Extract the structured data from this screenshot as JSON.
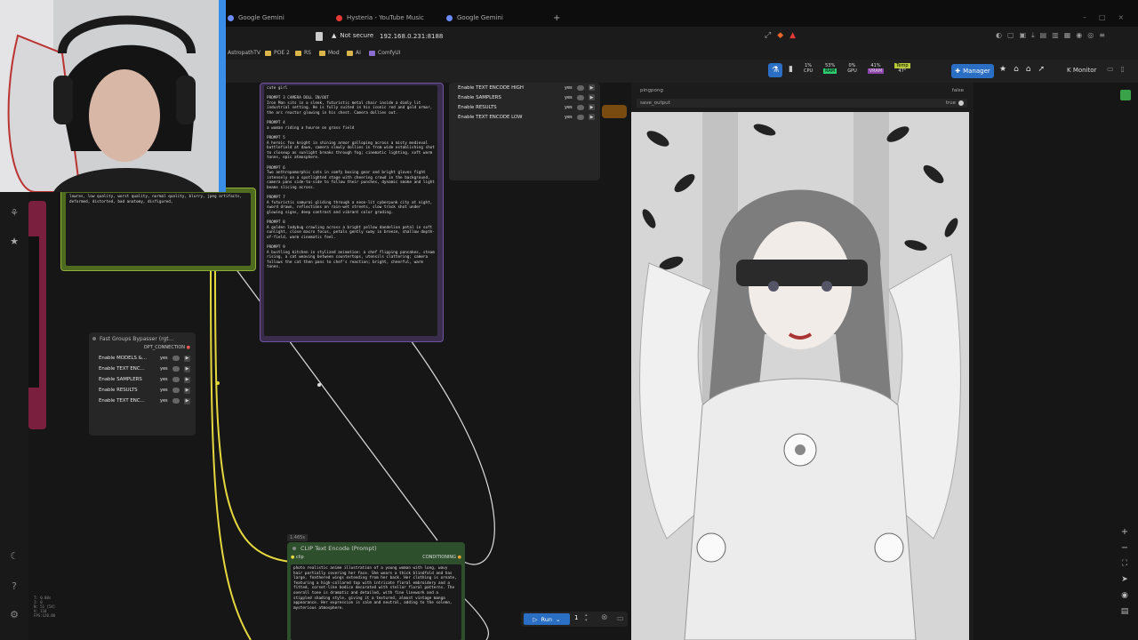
{
  "browser": {
    "tabs": [
      {
        "label": "Google Gemini",
        "accent": "#6b8cff"
      },
      {
        "label": "Hysteria - YouTube Music",
        "accent": "#e53935"
      },
      {
        "label": "Google Gemini",
        "accent": "#6b8cff"
      }
    ],
    "new_tab_glyph": "+",
    "security_label": "Not secure",
    "url": "192.168.0.231:8188",
    "bookmarks": [
      "AstropathTV",
      "POE 2",
      "RS",
      "Mod",
      "AI",
      "ComfyUI"
    ]
  },
  "comfy_toolbar": {
    "stats": [
      {
        "name": "CPU",
        "value": "1%",
        "color": "#2ecc71"
      },
      {
        "name": "RAM",
        "value": "53%",
        "color": "#2ecc71"
      },
      {
        "name": "GPU",
        "value": "0%",
        "color": "#2ecc71"
      },
      {
        "name": "VRAM",
        "value": "41%",
        "color": "#8e44ad"
      },
      {
        "name": "Temp",
        "value": "47°",
        "color": "#b8c93a"
      }
    ],
    "manager_label": "Manager",
    "monitor_label": "Monitor"
  },
  "negative_prompt": {
    "text": "lowres, low quality, worst quality, normal quality, blurry, jpeg artifacts, deformed, distorted, bad anatomy, disfigured,",
    "pill_label": "ING"
  },
  "prompt_list": {
    "text": "cute girl\n\nPROMPT 3 CAMERA DOLL IN/OUT\nIron Man sits in a sleek, futuristic metal chair inside a dimly lit industrial setting. He is fully suited in his iconic red and gold armor, the arc reactor glowing in his chest. Camera dollies out.\n\nPROMPT 4\na woman riding a hourse on grass field\n\nPROMPT 5\nA heroic fox knight in shining armor galloping across a misty medieval battlefield at dawn, camera slowly dollies in from wide establishing shot to closeup as sunlight breaks through fog; cinematic lighting, soft warm tones, epic atmosphere.\n\nPROMPT 6\nTwo anthropomorphic cats in comfy boxing gear and bright gloves fight intensely on a spotlighted stage with cheering crowd in the background, camera pans side-to-side to follow their punches, dynamic smoke and light beams slicing across.\n\nPROMPT 7\nA futuristic samurai gliding through a neon-lit cyberpunk city at night, sword drawn, reflections on rain-wet streets, slow track shot under glowing signs, deep contrast and vibrant color grading.\n\nPROMPT 8\nA golden ladybug crawling across a bright yellow dandelion petal in soft sunlight, close macro focus, petals gently sway in breeze, shallow depth-of-field, warm cinematic feel.\n\nPROMPT 9\nA bustling kitchen in stylized animation: a chef flipping pancakes, steam rising, a cat weaving between countertops, utensils clattering; camera follows the cat then pans to chef's reaction; bright, cheerful, warm tones."
  },
  "bypasser_top": {
    "rows": [
      {
        "label": "Enable TEXT ENCODE HIGH",
        "value": "yes"
      },
      {
        "label": "Enable SAMPLERS",
        "value": "yes"
      },
      {
        "label": "Enable RESULTS",
        "value": "yes"
      },
      {
        "label": "Enable TEXT ENCODE LOW",
        "value": "yes"
      }
    ]
  },
  "bypasser": {
    "title": "Fast Groups Bypasser (rgt...",
    "output": "OPT_CONNECTION",
    "rows": [
      {
        "label": "Enable MODELS &...",
        "value": "yes"
      },
      {
        "label": "Enable TEXT ENC...",
        "value": "yes"
      },
      {
        "label": "Enable SAMPLERS",
        "value": "yes"
      },
      {
        "label": "Enable RESULTS",
        "value": "yes"
      },
      {
        "label": "Enable TEXT ENC...",
        "value": "yes"
      }
    ]
  },
  "clip_node": {
    "badge": "1.465s",
    "title": "CLIP Text Encode (Prompt)",
    "input": "clip",
    "output": "CONDITIONING",
    "text": "photo realistic anime illustration of a young woman with long, wavy hair partially covering her face. She wears a thick blindfold and has large, feathered wings extending from her back. Her clothing is ornate, featuring a high-collared top with intricate floral embroidery and a fitted, corset-like bodice decorated with stellar floral patterns. The overall tone is dramatic and detailed, with fine linework and a stippled shading style, giving it a textured, almost vintage manga appearance. Her expression is calm and neutral, adding to the solemn, mysterious atmosphere."
  },
  "image_node": {
    "widgets": [
      {
        "label": "pingpong",
        "value": "false"
      },
      {
        "label": "save_output",
        "value": "true"
      }
    ]
  },
  "run_bar": {
    "run_label": "Run",
    "count": "1"
  },
  "stats_overlay": {
    "lines": [
      "T: 0.00s",
      "I: 0",
      "N: 51 [54]",
      "V: 118",
      "FPS:120.00"
    ]
  }
}
